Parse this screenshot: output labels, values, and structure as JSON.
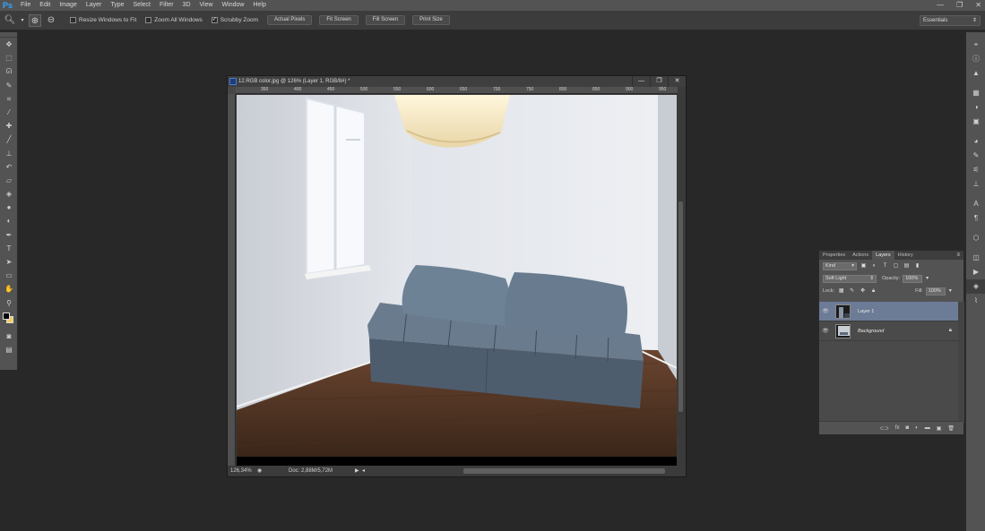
{
  "app": {
    "logo": "Ps"
  },
  "menu": [
    "File",
    "Edit",
    "Image",
    "Layer",
    "Type",
    "Select",
    "Filter",
    "3D",
    "View",
    "Window",
    "Help"
  ],
  "window_controls": [
    "—",
    "❐",
    "✕"
  ],
  "options_bar": {
    "tool_icon": "zoom-icon",
    "resize_windows": {
      "label": "Resize Windows to Fit",
      "checked": false
    },
    "zoom_all": {
      "label": "Zoom All Windows",
      "checked": false
    },
    "scrubby_zoom": {
      "label": "Scrubby Zoom",
      "checked": true
    },
    "buttons": [
      "Actual Pixels",
      "Fit Screen",
      "Fill Screen",
      "Print Size"
    ],
    "workspace": "Essentials"
  },
  "tools": [
    "move-icon",
    "marquee-icon",
    "lasso-icon",
    "quick-select-icon",
    "crop-icon",
    "eyedropper-icon",
    "healing-icon",
    "brush-icon",
    "stamp-icon",
    "history-brush-icon",
    "eraser-icon",
    "gradient-icon",
    "blur-icon",
    "dodge-icon",
    "pen-icon",
    "type-icon",
    "path-select-icon",
    "shape-icon",
    "hand-icon",
    "zoom-tool-icon"
  ],
  "document": {
    "title": "12.RGB color.jpg @ 126% (Layer 1, RGB/8#) *",
    "ruler_ticks": [
      "350",
      "400",
      "450",
      "500",
      "550",
      "600",
      "650",
      "700",
      "750",
      "800",
      "850",
      "900",
      "950"
    ],
    "zoom": "126,34%",
    "doc_info": "Doc: 2,88M/5,72M"
  },
  "layers_panel": {
    "tabs": [
      "Properties",
      "Actions",
      "Layers",
      "History"
    ],
    "active_tab": "Layers",
    "filter_kind": "Kind",
    "blend_mode": "Soft Light",
    "opacity_label": "Opacity:",
    "opacity": "100%",
    "lock_label": "Lock:",
    "fill_label": "Fill:",
    "fill": "100%",
    "layers": [
      {
        "name": "Layer 1",
        "selected": true
      },
      {
        "name": "Background",
        "selected": false,
        "locked": true
      }
    ]
  },
  "right_strip_icons": [
    "navigator-icon",
    "info-icon",
    "histogram-icon",
    "swatches-icon",
    "adjustments-icon",
    "styles-icon",
    "color-icon",
    "brush-presets-icon",
    "clone-source-icon",
    "character-icon",
    "paragraph-icon",
    "3d-icon",
    "channels-icon",
    "actions-icon",
    "layers-icon",
    "paths-icon"
  ],
  "colors": {
    "accent": "#31a8ff",
    "selected_layer": "#6c7b96",
    "sofa": "#59697a",
    "floor": "#5a3a26"
  }
}
